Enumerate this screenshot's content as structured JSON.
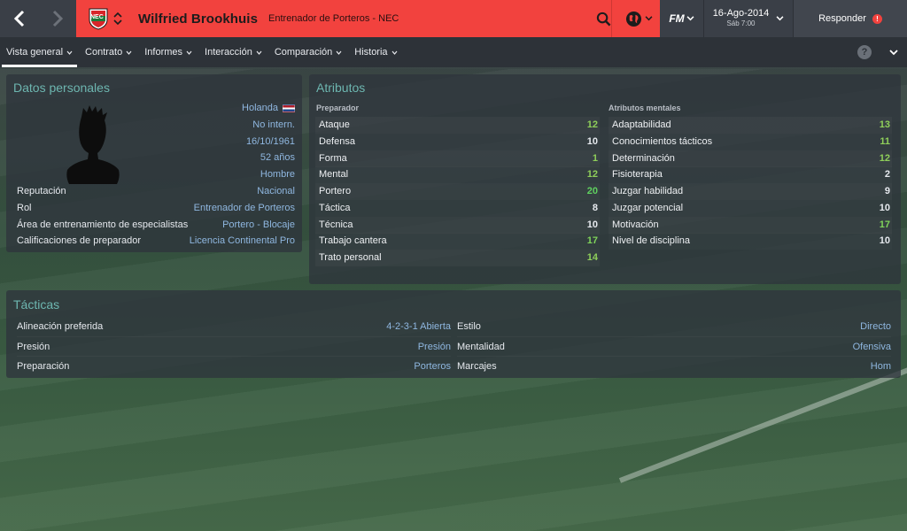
{
  "header": {
    "club_badge_text": "NEC",
    "person_name": "Wilfried Brookhuis",
    "person_role": "Entrenador de Porteros - NEC",
    "fm_label": "FM",
    "date": "16-Ago-2014",
    "time": "Sáb 7:00",
    "respond_label": "Responder",
    "alert_count": "!"
  },
  "tabs": [
    {
      "label": "Vista general",
      "active": true
    },
    {
      "label": "Contrato"
    },
    {
      "label": "Informes"
    },
    {
      "label": "Interacción"
    },
    {
      "label": "Comparación"
    },
    {
      "label": "Historia"
    }
  ],
  "help_label": "?",
  "personal": {
    "title": "Datos personales",
    "nationality": "Holanda",
    "caps": "No intern.",
    "dob": "16/10/1961",
    "age": "52 años",
    "gender": "Hombre",
    "rows": [
      {
        "label": "Reputación",
        "value": "Nacional"
      },
      {
        "label": "Rol",
        "value": "Entrenador de Porteros"
      },
      {
        "label": "Área de entrenamiento de especialistas",
        "value": "Portero - Blocaje"
      },
      {
        "label": "Calificaciones de preparador",
        "value": "Licencia Continental Pro"
      }
    ]
  },
  "attributes": {
    "title": "Atributos",
    "coach_heading": "Preparador",
    "mental_heading": "Atributos mentales",
    "coach": [
      {
        "label": "Ataque",
        "value": "12",
        "color": "#8fcf5a"
      },
      {
        "label": "Defensa",
        "value": "10",
        "color": "#e6e9ee"
      },
      {
        "label": "Forma",
        "value": "1",
        "color": "#8fcf5a"
      },
      {
        "label": "Mental",
        "value": "12",
        "color": "#8fcf5a"
      },
      {
        "label": "Portero",
        "value": "20",
        "color": "#5fd15f"
      },
      {
        "label": "Táctica",
        "value": "8",
        "color": "#e6e9ee"
      },
      {
        "label": "Técnica",
        "value": "10",
        "color": "#e6e9ee"
      },
      {
        "label": "Trabajo cantera",
        "value": "17",
        "color": "#7fd45a"
      },
      {
        "label": "Trato personal",
        "value": "14",
        "color": "#8fcf5a"
      }
    ],
    "mental": [
      {
        "label": "Adaptabilidad",
        "value": "13",
        "color": "#8fcf5a"
      },
      {
        "label": "Conocimientos tácticos",
        "value": "11",
        "color": "#8fcf5a"
      },
      {
        "label": "Determinación",
        "value": "12",
        "color": "#8fcf5a"
      },
      {
        "label": "Fisioterapia",
        "value": "2",
        "color": "#e6e9ee"
      },
      {
        "label": "Juzgar habilidad",
        "value": "9",
        "color": "#e6e9ee"
      },
      {
        "label": "Juzgar potencial",
        "value": "10",
        "color": "#e6e9ee"
      },
      {
        "label": "Motivación",
        "value": "17",
        "color": "#7fd45a"
      },
      {
        "label": "Nivel de disciplina",
        "value": "10",
        "color": "#e6e9ee"
      }
    ]
  },
  "tactics": {
    "title": "Tácticas",
    "left": [
      {
        "label": "Alineación preferida",
        "value": "4-2-3-1 Abierta"
      },
      {
        "label": "Presión",
        "value": "Presión"
      },
      {
        "label": "Preparación",
        "value": "Porteros"
      }
    ],
    "right": [
      {
        "label": "Estilo",
        "value": "Directo"
      },
      {
        "label": "Mentalidad",
        "value": "Ofensiva"
      },
      {
        "label": "Marcajes",
        "value": "Hom"
      }
    ]
  }
}
